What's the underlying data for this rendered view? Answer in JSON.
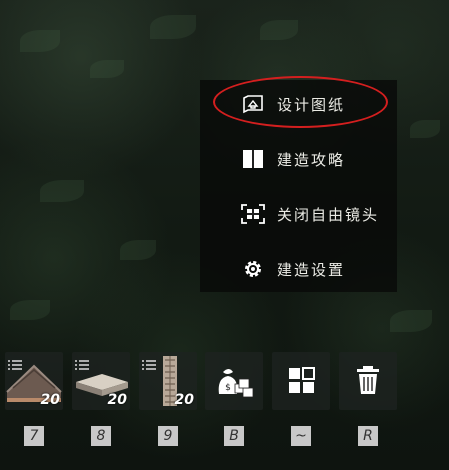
{
  "menu": {
    "items": [
      {
        "label": "设计图纸",
        "icon": "blueprint-icon"
      },
      {
        "label": "建造攻略",
        "icon": "book-icon"
      },
      {
        "label": "关闭自由镜头",
        "icon": "camera-frame-icon"
      },
      {
        "label": "建造设置",
        "icon": "gear-icon"
      }
    ],
    "highlight_color": "#d41f1f"
  },
  "hotbar": {
    "slots": [
      {
        "item": "roof-slope-piece",
        "count": "20",
        "key": "7"
      },
      {
        "item": "flat-foundation-piece",
        "count": "20",
        "key": "8"
      },
      {
        "item": "wall-pillar-piece",
        "count": "20",
        "key": "9"
      },
      {
        "item": "resource-bag-icon",
        "count": "",
        "key": "B"
      },
      {
        "item": "grid-blocks-icon",
        "count": "",
        "key": "~"
      },
      {
        "item": "trash-icon",
        "count": "",
        "key": "R"
      }
    ]
  }
}
